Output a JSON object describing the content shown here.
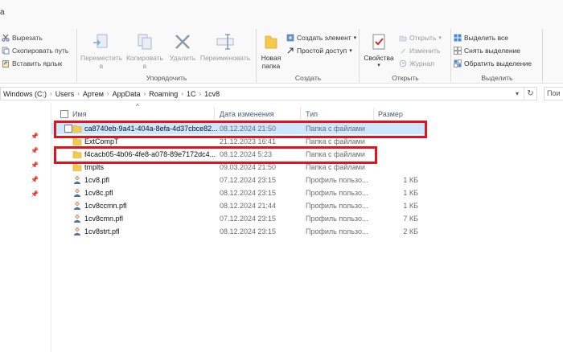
{
  "ribbon": {
    "title_stub": "а",
    "clipboard": {
      "cut": "Вырезать",
      "copy_path": "Скопировать путь",
      "paste_shortcut": "Вставить ярлык"
    },
    "organize": {
      "move_to": [
        "Переместить",
        "в"
      ],
      "copy_to": [
        "Копировать",
        "в"
      ],
      "delete": "Удалить",
      "rename": "Переименовать",
      "label": "Упорядочить"
    },
    "create": {
      "new_folder": [
        "Новая",
        "папка"
      ],
      "new_item": "Создать элемент",
      "easy_access": "Простой доступ",
      "label": "Создать"
    },
    "open": {
      "properties": "Свойства",
      "open": "Открыть",
      "edit": "Изменить",
      "history": "Журнал",
      "label": "Открыть"
    },
    "select": {
      "select_all": "Выделить все",
      "select_none": "Снять выделение",
      "invert": "Обратить выделение",
      "label": "Выделить"
    }
  },
  "address": {
    "crumbs": [
      "Windows (C:)",
      "Users",
      "Артем",
      "AppData",
      "Roaming",
      "1С",
      "1cv8"
    ],
    "search_placeholder": "Пои"
  },
  "list": {
    "columns": {
      "name": "Имя",
      "date": "Дата изменения",
      "type": "Тип",
      "size": "Размер"
    },
    "rows": [
      {
        "name": "ca8740eb-9a41-404a-8efa-4d37cbce82...",
        "date": "08.12.2024 21:50",
        "type": "Папка с файлами",
        "size": "",
        "kind": "folder",
        "selected": true
      },
      {
        "name": "ExtCompT",
        "date": "21.12.2023 16:41",
        "type": "Папка с файлами",
        "size": "",
        "kind": "folder",
        "selected": false
      },
      {
        "name": "f4cacb05-4b06-4fe8-a078-89e7172dc4...",
        "date": "08.12.2024 5:23",
        "type": "Папка с файлами",
        "size": "",
        "kind": "folder",
        "selected": false
      },
      {
        "name": "tmplts",
        "date": "09.03.2024 21:50",
        "type": "Папка с файлами",
        "size": "",
        "kind": "folder",
        "selected": false
      },
      {
        "name": "1cv8.pfl",
        "date": "07.12.2024 23:15",
        "type": "Профиль пользо...",
        "size": "1 КБ",
        "kind": "file",
        "selected": false
      },
      {
        "name": "1cv8c.pfl",
        "date": "08.12.2024 23:15",
        "type": "Профиль пользо...",
        "size": "1 КБ",
        "kind": "file",
        "selected": false
      },
      {
        "name": "1cv8ccmn.pfl",
        "date": "08.12.2024 21:44",
        "type": "Профиль пользо...",
        "size": "1 КБ",
        "kind": "file",
        "selected": false
      },
      {
        "name": "1cv8cmn.pfl",
        "date": "07.12.2024 23:15",
        "type": "Профиль пользо...",
        "size": "7 КБ",
        "kind": "file",
        "selected": false
      },
      {
        "name": "1cv8strt.pfl",
        "date": "08.12.2024 23:15",
        "type": "Профиль пользо...",
        "size": "2 КБ",
        "kind": "file",
        "selected": false
      }
    ]
  },
  "colors": {
    "highlight": "#e0141e",
    "selection": "#cce8ff",
    "folder": "#f6c94a"
  }
}
